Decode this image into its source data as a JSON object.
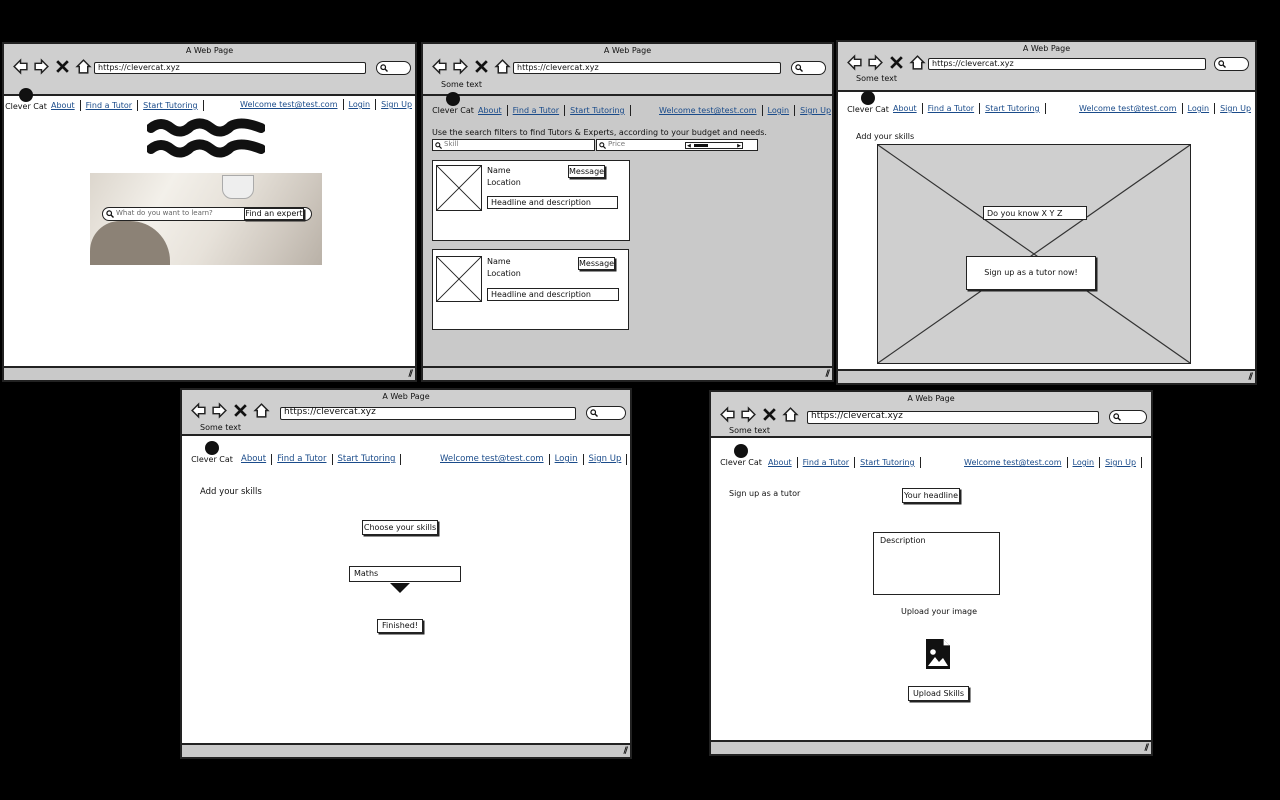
{
  "browser": {
    "window_title": "A Web Page",
    "url": "https://clevercat.xyz",
    "status_text": "Some text"
  },
  "site": {
    "brand": "Clever Cat",
    "nav": [
      "About",
      "Find a Tutor",
      "Start Tutoring"
    ],
    "welcome": "Welcome test@test.com",
    "login": "Login",
    "signup": "Sign Up"
  },
  "home": {
    "search_placeholder": "What do you want to learn?",
    "search_button": "Find an expert"
  },
  "find": {
    "intro": "Use the search filters to find Tutors & Experts, according to your budget and needs.",
    "skill_placeholder": "Skill",
    "price_placeholder": "Price",
    "cards": [
      {
        "name": "Name",
        "location": "Location",
        "message": "Message",
        "headline": "Headline and description"
      },
      {
        "name": "Name",
        "location": "Location",
        "message": "Message",
        "headline": "Headline and description"
      }
    ]
  },
  "start": {
    "heading": "Add your skills",
    "question": "Do you know X Y Z",
    "cta": "Sign up as a tutor now!"
  },
  "skills": {
    "heading": "Add your skills",
    "choose": "Choose your skills",
    "selected": "Maths",
    "finished": "Finished!"
  },
  "signup": {
    "heading": "Sign up as a tutor",
    "headline_field": "Your headline",
    "description_field": "Description",
    "upload_label": "Upload your image",
    "upload_button": "Upload Skills"
  }
}
